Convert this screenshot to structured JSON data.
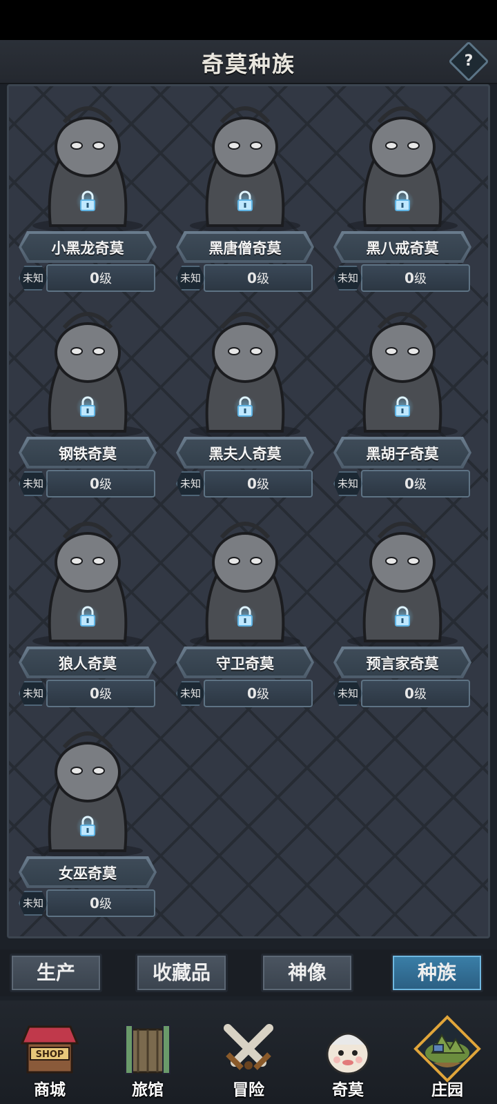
{
  "header": {
    "title": "奇莫种族",
    "help_label": "?"
  },
  "cards": [
    {
      "name": "小黑龙奇莫",
      "status": "未知",
      "level": "0",
      "level_unit": "级",
      "art_icon": "dragon-portrait-icon"
    },
    {
      "name": "黑唐僧奇莫",
      "status": "未知",
      "level": "0",
      "level_unit": "级",
      "art_icon": "monk-portrait-icon"
    },
    {
      "name": "黑八戒奇莫",
      "status": "未知",
      "level": "0",
      "level_unit": "级",
      "art_icon": "pig-warrior-portrait-icon"
    },
    {
      "name": "钢铁奇莫",
      "status": "未知",
      "level": "0",
      "level_unit": "级",
      "art_icon": "iron-armor-portrait-icon"
    },
    {
      "name": "黑夫人奇莫",
      "status": "未知",
      "level": "0",
      "level_unit": "级",
      "art_icon": "lady-portrait-icon"
    },
    {
      "name": "黑胡子奇莫",
      "status": "未知",
      "level": "0",
      "level_unit": "级",
      "art_icon": "pirate-portrait-icon"
    },
    {
      "name": "狼人奇莫",
      "status": "未知",
      "level": "0",
      "level_unit": "级",
      "art_icon": "werewolf-portrait-icon"
    },
    {
      "name": "守卫奇莫",
      "status": "未知",
      "level": "0",
      "level_unit": "级",
      "art_icon": "guard-portrait-icon"
    },
    {
      "name": "预言家奇莫",
      "status": "未知",
      "level": "0",
      "level_unit": "级",
      "art_icon": "seer-portrait-icon"
    },
    {
      "name": "女巫奇莫",
      "status": "未知",
      "level": "0",
      "level_unit": "级",
      "art_icon": "witch-portrait-icon"
    }
  ],
  "tabs": [
    {
      "label": "生产",
      "active": false
    },
    {
      "label": "收藏品",
      "active": false
    },
    {
      "label": "神像",
      "active": false
    },
    {
      "label": "种族",
      "active": true
    }
  ],
  "bottom_nav": [
    {
      "label": "商城",
      "icon": "shop-icon",
      "badge_text": "SHOP"
    },
    {
      "label": "旅馆",
      "icon": "inn-gate-icon"
    },
    {
      "label": "冒险",
      "icon": "crossed-swords-icon"
    },
    {
      "label": "奇莫",
      "icon": "qimo-character-icon"
    },
    {
      "label": "庄园",
      "icon": "manor-island-icon"
    }
  ],
  "colors": {
    "active_tab": "#2b5e82",
    "lock_glow": "#78d2ff",
    "accent_gold": "#e0a53a"
  }
}
